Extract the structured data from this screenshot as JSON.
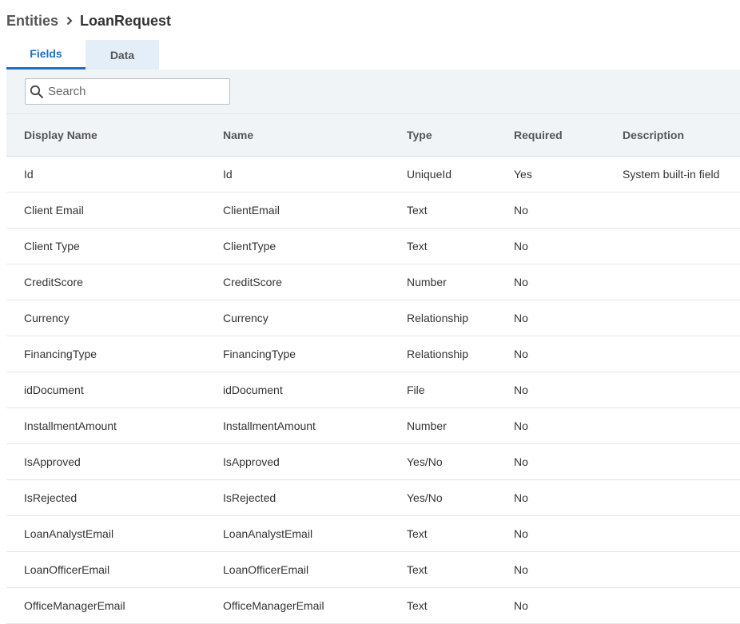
{
  "breadcrumb": {
    "root": "Entities",
    "current": "LoanRequest"
  },
  "tabs": [
    {
      "label": "Fields",
      "active": true
    },
    {
      "label": "Data",
      "active": false
    }
  ],
  "search": {
    "placeholder": "Search",
    "value": ""
  },
  "table": {
    "columns": [
      "Display Name",
      "Name",
      "Type",
      "Required",
      "Description"
    ],
    "rows": [
      {
        "display_name": "Id",
        "name": "Id",
        "type": "UniqueId",
        "required": "Yes",
        "description": "System built-in field"
      },
      {
        "display_name": "Client Email",
        "name": "ClientEmail",
        "type": "Text",
        "required": "No",
        "description": ""
      },
      {
        "display_name": "Client Type",
        "name": "ClientType",
        "type": "Text",
        "required": "No",
        "description": ""
      },
      {
        "display_name": "CreditScore",
        "name": "CreditScore",
        "type": "Number",
        "required": "No",
        "description": ""
      },
      {
        "display_name": "Currency",
        "name": "Currency",
        "type": "Relationship",
        "required": "No",
        "description": ""
      },
      {
        "display_name": "FinancingType",
        "name": "FinancingType",
        "type": "Relationship",
        "required": "No",
        "description": ""
      },
      {
        "display_name": "idDocument",
        "name": "idDocument",
        "type": "File",
        "required": "No",
        "description": ""
      },
      {
        "display_name": "InstallmentAmount",
        "name": "InstallmentAmount",
        "type": "Number",
        "required": "No",
        "description": ""
      },
      {
        "display_name": "IsApproved",
        "name": "IsApproved",
        "type": "Yes/No",
        "required": "No",
        "description": ""
      },
      {
        "display_name": "IsRejected",
        "name": "IsRejected",
        "type": "Yes/No",
        "required": "No",
        "description": ""
      },
      {
        "display_name": "LoanAnalystEmail",
        "name": "LoanAnalystEmail",
        "type": "Text",
        "required": "No",
        "description": ""
      },
      {
        "display_name": "LoanOfficerEmail",
        "name": "LoanOfficerEmail",
        "type": "Text",
        "required": "No",
        "description": ""
      },
      {
        "display_name": "OfficeManagerEmail",
        "name": "OfficeManagerEmail",
        "type": "Text",
        "required": "No",
        "description": ""
      }
    ]
  },
  "colors": {
    "accent": "#1f6fc5",
    "inactive_tab_bg": "#e4eef9",
    "header_bg": "#f0f4f7"
  },
  "icons": {
    "breadcrumb_separator": "chevron-right-icon",
    "search": "search-icon"
  }
}
